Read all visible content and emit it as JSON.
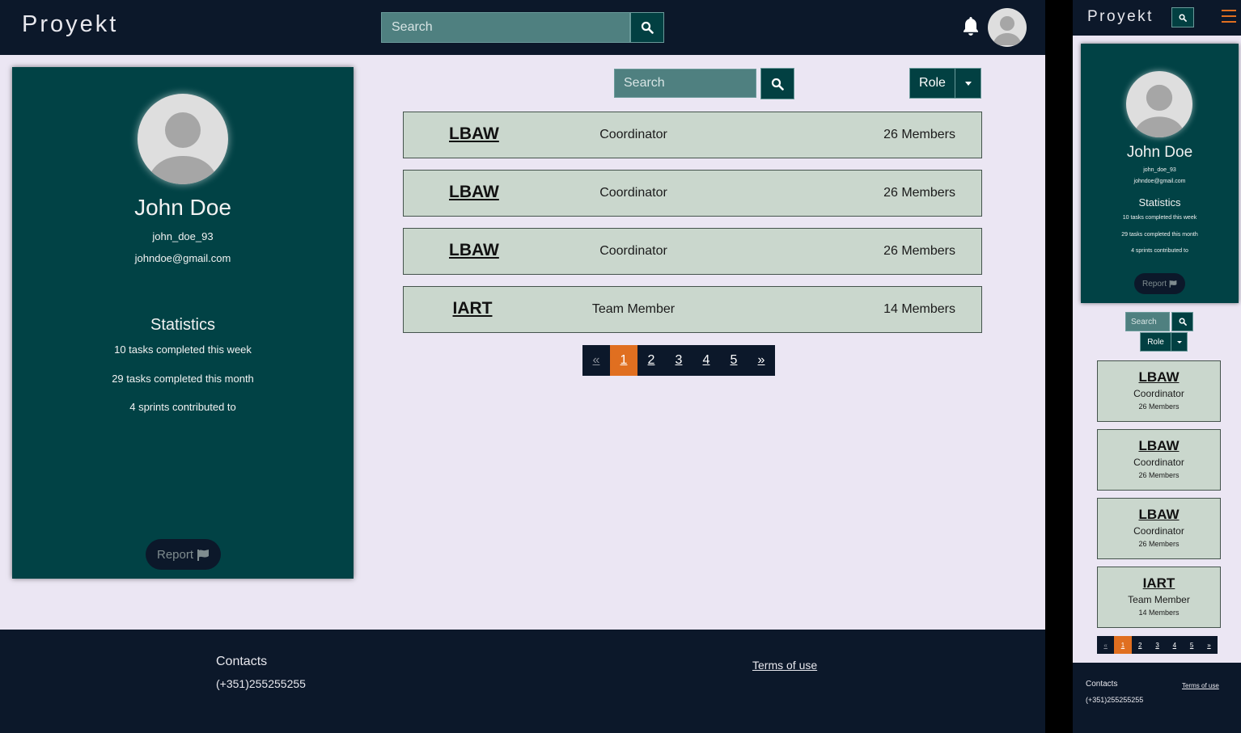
{
  "app": {
    "brand": "Proyekt"
  },
  "header": {
    "search_placeholder": "Search",
    "search_icon": "search-icon",
    "notification_icon": "bell-icon",
    "menu_icon": "hamburger-icon"
  },
  "profile": {
    "name": "John Doe",
    "username": "john_doe_93",
    "email": "johndoe@gmail.com",
    "stats_title": "Statistics",
    "stats": [
      "10 tasks completed this week",
      "29 tasks completed this month",
      "4 sprints contributed to"
    ],
    "report_label": "Report",
    "report_icon": "flag-icon"
  },
  "filters": {
    "search_placeholder": "Search",
    "role_label": "Role"
  },
  "projects": [
    {
      "name": "LBAW",
      "role": "Coordinator",
      "members": "26 Members"
    },
    {
      "name": "LBAW",
      "role": "Coordinator",
      "members": "26 Members"
    },
    {
      "name": "LBAW",
      "role": "Coordinator",
      "members": "26 Members"
    },
    {
      "name": "IART",
      "role": "Team Member",
      "members": "14 Members"
    }
  ],
  "pagination": {
    "prev": "«",
    "pages": [
      "1",
      "2",
      "3",
      "4",
      "5"
    ],
    "next": "»",
    "active": "1"
  },
  "footer": {
    "contacts_title": "Contacts",
    "phone": "(+351)255255255",
    "terms": "Terms of use"
  },
  "colors": {
    "navbar": "#0c182a",
    "card": "#014245",
    "accent": "#e06f20",
    "row": "#cad7cd",
    "page_bg": "#ebe6f3"
  }
}
